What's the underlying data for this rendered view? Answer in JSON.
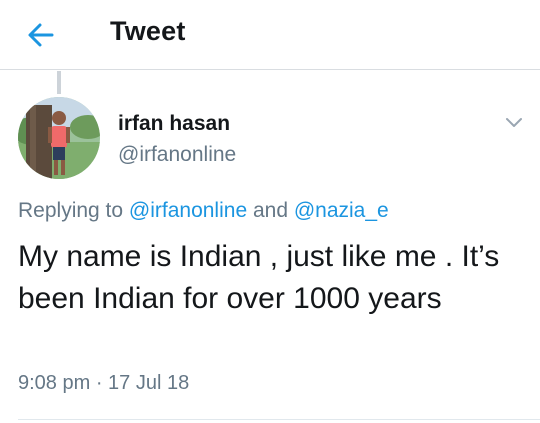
{
  "colors": {
    "accent": "#1b95e0",
    "text_primary": "#14171a",
    "text_secondary": "#657786",
    "divider": "#d9dde1",
    "thread_line": "#cdd3d9"
  },
  "header": {
    "back_icon": "arrow-left-icon",
    "title": "Tweet"
  },
  "tweet": {
    "author": {
      "display_name": "irfan hasan",
      "handle": "@irfanonline",
      "avatar_icon": "profile-photo"
    },
    "menu_icon": "chevron-down-icon",
    "reply_context": {
      "prefix": "Replying to ",
      "mention_1": "@irfanonline",
      "connector": " and ",
      "mention_2": "@nazia_e"
    },
    "text": "My name is Indian , just like me . It’s been Indian for over 1000 years",
    "time": "9:08 pm",
    "separator": " · ",
    "date": "17 Jul 18"
  }
}
